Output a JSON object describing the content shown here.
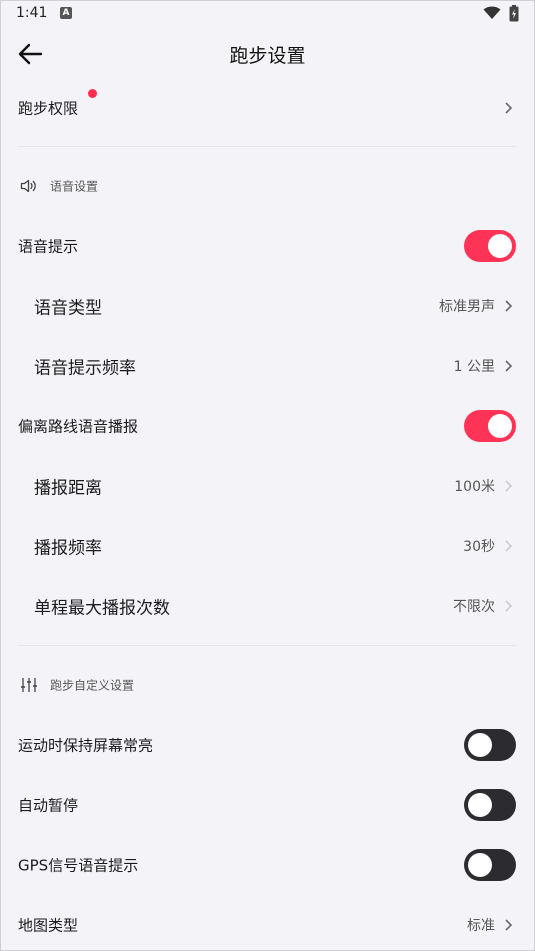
{
  "status_bar": {
    "time": "1:41",
    "indicator": "A"
  },
  "header": {
    "title": "跑步设置"
  },
  "permissions": {
    "label": "跑步权限"
  },
  "voice_section": {
    "title": "语音设置",
    "voice_prompt": {
      "label": "语音提示",
      "on": true
    },
    "voice_type": {
      "label": "语音类型",
      "value": "标准男声"
    },
    "prompt_frequency": {
      "label": "语音提示频率",
      "value": "1 公里"
    },
    "off_route": {
      "label": "偏离路线语音播报",
      "on": true
    },
    "broadcast_distance": {
      "label": "播报距离",
      "value": "100米"
    },
    "broadcast_frequency": {
      "label": "播报频率",
      "value": "30秒"
    },
    "max_broadcasts": {
      "label": "单程最大播报次数",
      "value": "不限次"
    }
  },
  "custom_section": {
    "title": "跑步自定义设置",
    "keep_screen_on": {
      "label": "运动时保持屏幕常亮",
      "on": false
    },
    "auto_pause": {
      "label": "自动暂停",
      "on": false
    },
    "gps_prompt": {
      "label": "GPS信号语音提示",
      "on": false
    },
    "map_type": {
      "label": "地图类型",
      "value": "标准"
    }
  },
  "colors": {
    "accent": "#ff3355",
    "toggle_off": "#2c2c30",
    "background": "#f4f4f8",
    "badge": "#ff2d4b"
  }
}
